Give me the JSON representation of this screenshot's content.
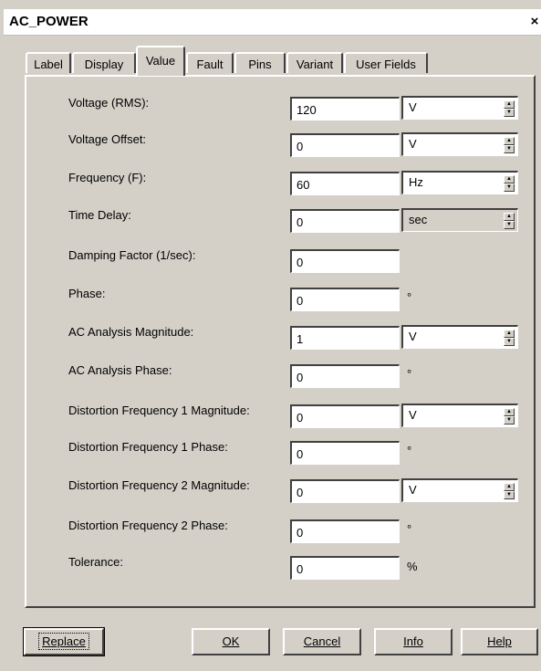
{
  "window": {
    "title": "AC_POWER",
    "close_glyph": "×"
  },
  "tabs": [
    {
      "label": "Label",
      "active": false
    },
    {
      "label": "Display",
      "active": false
    },
    {
      "label": "Value",
      "active": true
    },
    {
      "label": "Fault",
      "active": false
    },
    {
      "label": "Pins",
      "active": false
    },
    {
      "label": "Variant",
      "active": false
    },
    {
      "label": "User Fields",
      "active": false
    }
  ],
  "rows": [
    {
      "label": "Voltage (RMS):",
      "value": "120",
      "unit": "V"
    },
    {
      "label": "Voltage Offset:",
      "value": "0",
      "unit": "V"
    },
    {
      "label": "Frequency (F):",
      "value": "60",
      "unit": "Hz"
    },
    {
      "label": "Time Delay:",
      "value": "0",
      "unit": "sec"
    },
    {
      "label": "Damping Factor (1/sec):",
      "value": "0",
      "unit": ""
    },
    {
      "label": "Phase:",
      "value": "0",
      "unit": "°"
    },
    {
      "label": "AC Analysis Magnitude:",
      "value": "1",
      "unit": "V"
    },
    {
      "label": "AC Analysis Phase:",
      "value": "0",
      "unit": "°"
    },
    {
      "label": "Distortion Frequency 1 Magnitude:",
      "value": "0",
      "unit": "V"
    },
    {
      "label": "Distortion Frequency 1 Phase:",
      "value": "0",
      "unit": "°"
    },
    {
      "label": "Distortion Frequency 2 Magnitude:",
      "value": "0",
      "unit": "V"
    },
    {
      "label": "Distortion Frequency 2 Phase:",
      "value": "0",
      "unit": "°"
    },
    {
      "label": "Tolerance:",
      "value": "0",
      "unit": "%"
    }
  ],
  "buttons": {
    "replace": "Replace",
    "ok": "OK",
    "cancel": "Cancel",
    "info": "Info",
    "help": "Help"
  },
  "colors": {
    "face": "#d4d0c8",
    "field": "#ffffff",
    "shadow": "#404040"
  }
}
